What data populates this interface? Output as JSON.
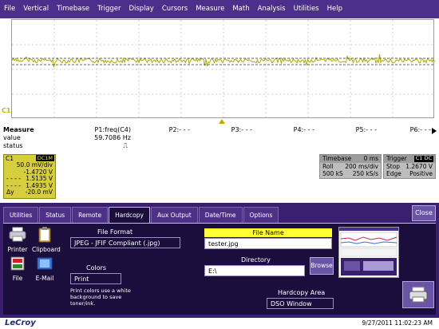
{
  "menu": [
    "File",
    "Vertical",
    "Timebase",
    "Trigger",
    "Display",
    "Cursors",
    "Measure",
    "Math",
    "Analysis",
    "Utilities",
    "Help"
  ],
  "colors": {
    "menu_bg": "#4b2f8a",
    "trace": "#b3a800",
    "panel_bg": "#3a1f6e",
    "field_header": "#ffff33",
    "channel": "#d6ce3c"
  },
  "grid": {
    "channel_marker": "C1"
  },
  "measure": {
    "title": "Measure",
    "row_labels": [
      "value",
      "status"
    ],
    "params": [
      {
        "name": "P1:freq(C4)",
        "value": "59.7086 Hz",
        "status": "⎍"
      },
      {
        "name": "P2:- - -",
        "value": "",
        "status": ""
      },
      {
        "name": "P3:- - -",
        "value": "",
        "status": ""
      },
      {
        "name": "P4:- - -",
        "value": "",
        "status": ""
      },
      {
        "name": "P5:- - -",
        "value": "",
        "status": ""
      },
      {
        "name": "P6:- - -",
        "value": "",
        "status": ""
      }
    ],
    "next_icon": "triangle-right-icon"
  },
  "channel": {
    "name": "C1",
    "coupling": "DC1M",
    "scale": "50.0 mV/div",
    "offset": "-1.4720 V",
    "lines": [
      {
        "prefix": "- - - -",
        "value": "1.5135 V"
      },
      {
        "prefix": "- - - -",
        "value": "1.4935 V"
      },
      {
        "prefix": "Δy",
        "value": "-20.0 mV"
      }
    ]
  },
  "timebase": {
    "label": "Timebase",
    "delay": "0 ms",
    "mode": "Roll",
    "per_div": "200 ms/div",
    "samples": "500 kS",
    "rate": "250 kS/s"
  },
  "trigger": {
    "label": "Trigger",
    "source": "C1 DC",
    "mode": "Stop",
    "level": "1.2670 V",
    "type": "Edge",
    "slope": "Positive"
  },
  "dialog": {
    "tabs": [
      "Utilities",
      "Status",
      "Remote",
      "Hardcopy",
      "Aux Output",
      "Date/Time",
      "Options"
    ],
    "active_tab": "Hardcopy",
    "close_label": "Close",
    "devices": [
      "Printer",
      "Clipboard",
      "File",
      "E-Mail"
    ],
    "file_format_label": "File Format",
    "file_format_value": "JPEG - JFIF Compliant (.jpg)",
    "colors_label": "Colors",
    "colors_value": "Print",
    "print_note": "Print colors use a white background to save toner/ink.",
    "file_name_label": "File Name",
    "file_name_value": "tester.jpg",
    "directory_label": "Directory",
    "directory_value": "E:\\",
    "browse_label": "Browse",
    "hardcopy_area_label": "Hardcopy Area",
    "hardcopy_area_value": "DSO Window"
  },
  "footer": {
    "brand": "LeCroy",
    "datetime": "9/27/2011 11:02:23 AM"
  }
}
